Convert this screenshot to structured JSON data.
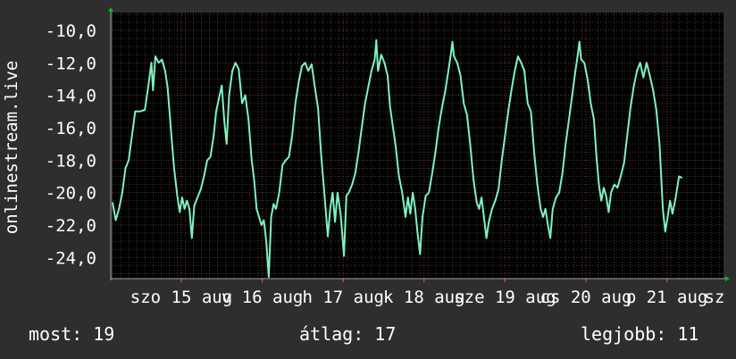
{
  "chart_data": {
    "type": "line",
    "ylabel": "onlinestream.live",
    "ylim": [
      -25.3,
      -8.9
    ],
    "y_ticks": [
      "-10,0",
      "-12,0",
      "-14,0",
      "-16,0",
      "-18,0",
      "-20,0",
      "-22,0",
      "-24,0"
    ],
    "y_tick_values": [
      -10,
      -12,
      -14,
      -16,
      -18,
      -20,
      -22,
      -24
    ],
    "x_range": [
      0,
      7.55
    ],
    "x_ticks": [
      {
        "label": "szo 15 aug",
        "x": 0.85
      },
      {
        "label": "v 16 aug",
        "x": 1.85
      },
      {
        "label": "h 17 aug",
        "x": 2.85
      },
      {
        "label": "k 18 aug",
        "x": 3.85
      },
      {
        "label": "sze 19 aug",
        "x": 4.85
      },
      {
        "label": "cs 20 aug",
        "x": 5.85
      },
      {
        "label": "p 21 aug",
        "x": 6.85
      },
      {
        "label": "sz",
        "x": 7.85
      }
    ],
    "grid": true,
    "series": [
      {
        "color": "#7ff2c0",
        "points": [
          [
            0.0,
            -20.6
          ],
          [
            0.04,
            -21.7
          ],
          [
            0.08,
            -21.0
          ],
          [
            0.12,
            -20.0
          ],
          [
            0.16,
            -18.5
          ],
          [
            0.2,
            -18.0
          ],
          [
            0.24,
            -16.5
          ],
          [
            0.28,
            -15.0
          ],
          [
            0.34,
            -15.0
          ],
          [
            0.4,
            -14.9
          ],
          [
            0.44,
            -13.5
          ],
          [
            0.48,
            -12.0
          ],
          [
            0.5,
            -13.7
          ],
          [
            0.53,
            -11.6
          ],
          [
            0.57,
            -12.0
          ],
          [
            0.61,
            -11.8
          ],
          [
            0.65,
            -12.5
          ],
          [
            0.68,
            -13.5
          ],
          [
            0.72,
            -16.0
          ],
          [
            0.76,
            -18.5
          ],
          [
            0.8,
            -20.2
          ],
          [
            0.83,
            -21.2
          ],
          [
            0.86,
            -20.3
          ],
          [
            0.89,
            -21.0
          ],
          [
            0.92,
            -20.5
          ],
          [
            0.95,
            -21.0
          ],
          [
            0.98,
            -22.8
          ],
          [
            1.01,
            -20.8
          ],
          [
            1.05,
            -20.3
          ],
          [
            1.09,
            -19.8
          ],
          [
            1.13,
            -19.0
          ],
          [
            1.17,
            -18.0
          ],
          [
            1.21,
            -17.8
          ],
          [
            1.25,
            -16.5
          ],
          [
            1.28,
            -15.0
          ],
          [
            1.31,
            -14.3
          ],
          [
            1.35,
            -13.4
          ],
          [
            1.38,
            -15.5
          ],
          [
            1.41,
            -17.0
          ],
          [
            1.44,
            -14.0
          ],
          [
            1.48,
            -12.5
          ],
          [
            1.52,
            -12.0
          ],
          [
            1.56,
            -12.4
          ],
          [
            1.6,
            -14.5
          ],
          [
            1.64,
            -14.0
          ],
          [
            1.68,
            -15.5
          ],
          [
            1.72,
            -18.0
          ],
          [
            1.75,
            -19.2
          ],
          [
            1.78,
            -21.0
          ],
          [
            1.81,
            -21.5
          ],
          [
            1.84,
            -22.0
          ],
          [
            1.87,
            -21.7
          ],
          [
            1.9,
            -23.0
          ],
          [
            1.93,
            -25.2
          ],
          [
            1.96,
            -21.5
          ],
          [
            1.99,
            -20.7
          ],
          [
            2.02,
            -21.0
          ],
          [
            2.06,
            -20.0
          ],
          [
            2.1,
            -18.3
          ],
          [
            2.14,
            -18.0
          ],
          [
            2.18,
            -17.8
          ],
          [
            2.22,
            -16.5
          ],
          [
            2.26,
            -14.5
          ],
          [
            2.3,
            -13.2
          ],
          [
            2.34,
            -12.2
          ],
          [
            2.38,
            -12.0
          ],
          [
            2.42,
            -12.5
          ],
          [
            2.46,
            -12.1
          ],
          [
            2.5,
            -13.5
          ],
          [
            2.54,
            -14.8
          ],
          [
            2.58,
            -17.8
          ],
          [
            2.62,
            -20.2
          ],
          [
            2.66,
            -22.7
          ],
          [
            2.69,
            -21.0
          ],
          [
            2.72,
            -20.0
          ],
          [
            2.75,
            -21.8
          ],
          [
            2.78,
            -20.0
          ],
          [
            2.82,
            -21.4
          ],
          [
            2.86,
            -23.9
          ],
          [
            2.89,
            -20.2
          ],
          [
            2.92,
            -20.0
          ],
          [
            2.96,
            -19.5
          ],
          [
            3.0,
            -18.8
          ],
          [
            3.04,
            -17.5
          ],
          [
            3.08,
            -16.0
          ],
          [
            3.12,
            -14.5
          ],
          [
            3.16,
            -13.5
          ],
          [
            3.2,
            -12.5
          ],
          [
            3.24,
            -11.8
          ],
          [
            3.26,
            -10.6
          ],
          [
            3.28,
            -12.5
          ],
          [
            3.32,
            -11.5
          ],
          [
            3.36,
            -12.0
          ],
          [
            3.4,
            -12.8
          ],
          [
            3.43,
            -14.7
          ],
          [
            3.46,
            -15.8
          ],
          [
            3.5,
            -17.2
          ],
          [
            3.54,
            -19.0
          ],
          [
            3.58,
            -20.0
          ],
          [
            3.62,
            -21.5
          ],
          [
            3.65,
            -20.3
          ],
          [
            3.68,
            -21.3
          ],
          [
            3.71,
            -20.0
          ],
          [
            3.74,
            -21.0
          ],
          [
            3.77,
            -22.5
          ],
          [
            3.8,
            -23.8
          ],
          [
            3.83,
            -21.5
          ],
          [
            3.87,
            -20.2
          ],
          [
            3.91,
            -20.0
          ],
          [
            3.95,
            -18.8
          ],
          [
            3.99,
            -17.5
          ],
          [
            4.03,
            -16.0
          ],
          [
            4.07,
            -14.8
          ],
          [
            4.11,
            -13.8
          ],
          [
            4.15,
            -12.5
          ],
          [
            4.18,
            -11.5
          ],
          [
            4.2,
            -10.7
          ],
          [
            4.22,
            -11.6
          ],
          [
            4.26,
            -12.0
          ],
          [
            4.3,
            -12.8
          ],
          [
            4.34,
            -14.5
          ],
          [
            4.38,
            -15.2
          ],
          [
            4.42,
            -17.0
          ],
          [
            4.46,
            -19.2
          ],
          [
            4.5,
            -20.6
          ],
          [
            4.53,
            -21.0
          ],
          [
            4.56,
            -20.3
          ],
          [
            4.59,
            -21.5
          ],
          [
            4.62,
            -22.8
          ],
          [
            4.65,
            -21.8
          ],
          [
            4.69,
            -21.0
          ],
          [
            4.73,
            -20.5
          ],
          [
            4.77,
            -19.8
          ],
          [
            4.81,
            -18.0
          ],
          [
            4.85,
            -16.5
          ],
          [
            4.89,
            -15.0
          ],
          [
            4.93,
            -13.7
          ],
          [
            4.97,
            -12.5
          ],
          [
            5.01,
            -11.6
          ],
          [
            5.05,
            -12.0
          ],
          [
            5.09,
            -12.5
          ],
          [
            5.13,
            -14.5
          ],
          [
            5.17,
            -15.0
          ],
          [
            5.21,
            -17.5
          ],
          [
            5.25,
            -19.5
          ],
          [
            5.29,
            -21.0
          ],
          [
            5.32,
            -21.5
          ],
          [
            5.35,
            -21.0
          ],
          [
            5.38,
            -22.0
          ],
          [
            5.41,
            -22.8
          ],
          [
            5.44,
            -21.0
          ],
          [
            5.48,
            -20.3
          ],
          [
            5.52,
            -20.0
          ],
          [
            5.56,
            -18.8
          ],
          [
            5.6,
            -17.0
          ],
          [
            5.64,
            -15.5
          ],
          [
            5.68,
            -14.0
          ],
          [
            5.72,
            -12.5
          ],
          [
            5.75,
            -11.5
          ],
          [
            5.77,
            -10.7
          ],
          [
            5.79,
            -11.8
          ],
          [
            5.83,
            -12.0
          ],
          [
            5.87,
            -13.0
          ],
          [
            5.91,
            -14.5
          ],
          [
            5.95,
            -15.5
          ],
          [
            5.98,
            -17.8
          ],
          [
            6.01,
            -19.5
          ],
          [
            6.04,
            -20.5
          ],
          [
            6.07,
            -19.7
          ],
          [
            6.1,
            -20.2
          ],
          [
            6.13,
            -21.2
          ],
          [
            6.16,
            -20.0
          ],
          [
            6.2,
            -19.5
          ],
          [
            6.24,
            -19.7
          ],
          [
            6.28,
            -19.0
          ],
          [
            6.32,
            -18.2
          ],
          [
            6.36,
            -16.5
          ],
          [
            6.4,
            -14.8
          ],
          [
            6.44,
            -13.5
          ],
          [
            6.48,
            -12.5
          ],
          [
            6.52,
            -12.0
          ],
          [
            6.56,
            -12.9
          ],
          [
            6.6,
            -12.0
          ],
          [
            6.64,
            -12.8
          ],
          [
            6.68,
            -13.7
          ],
          [
            6.72,
            -14.9
          ],
          [
            6.76,
            -17.0
          ],
          [
            6.8,
            -21.0
          ],
          [
            6.83,
            -22.4
          ],
          [
            6.86,
            -21.5
          ],
          [
            6.89,
            -20.5
          ],
          [
            6.92,
            -21.3
          ],
          [
            6.96,
            -20.3
          ],
          [
            7.0,
            -19.0
          ],
          [
            7.04,
            -19.1
          ]
        ]
      }
    ]
  },
  "stats": {
    "now": "most: 19",
    "avg": "átlag: 17",
    "best": "legjobb: 11"
  }
}
